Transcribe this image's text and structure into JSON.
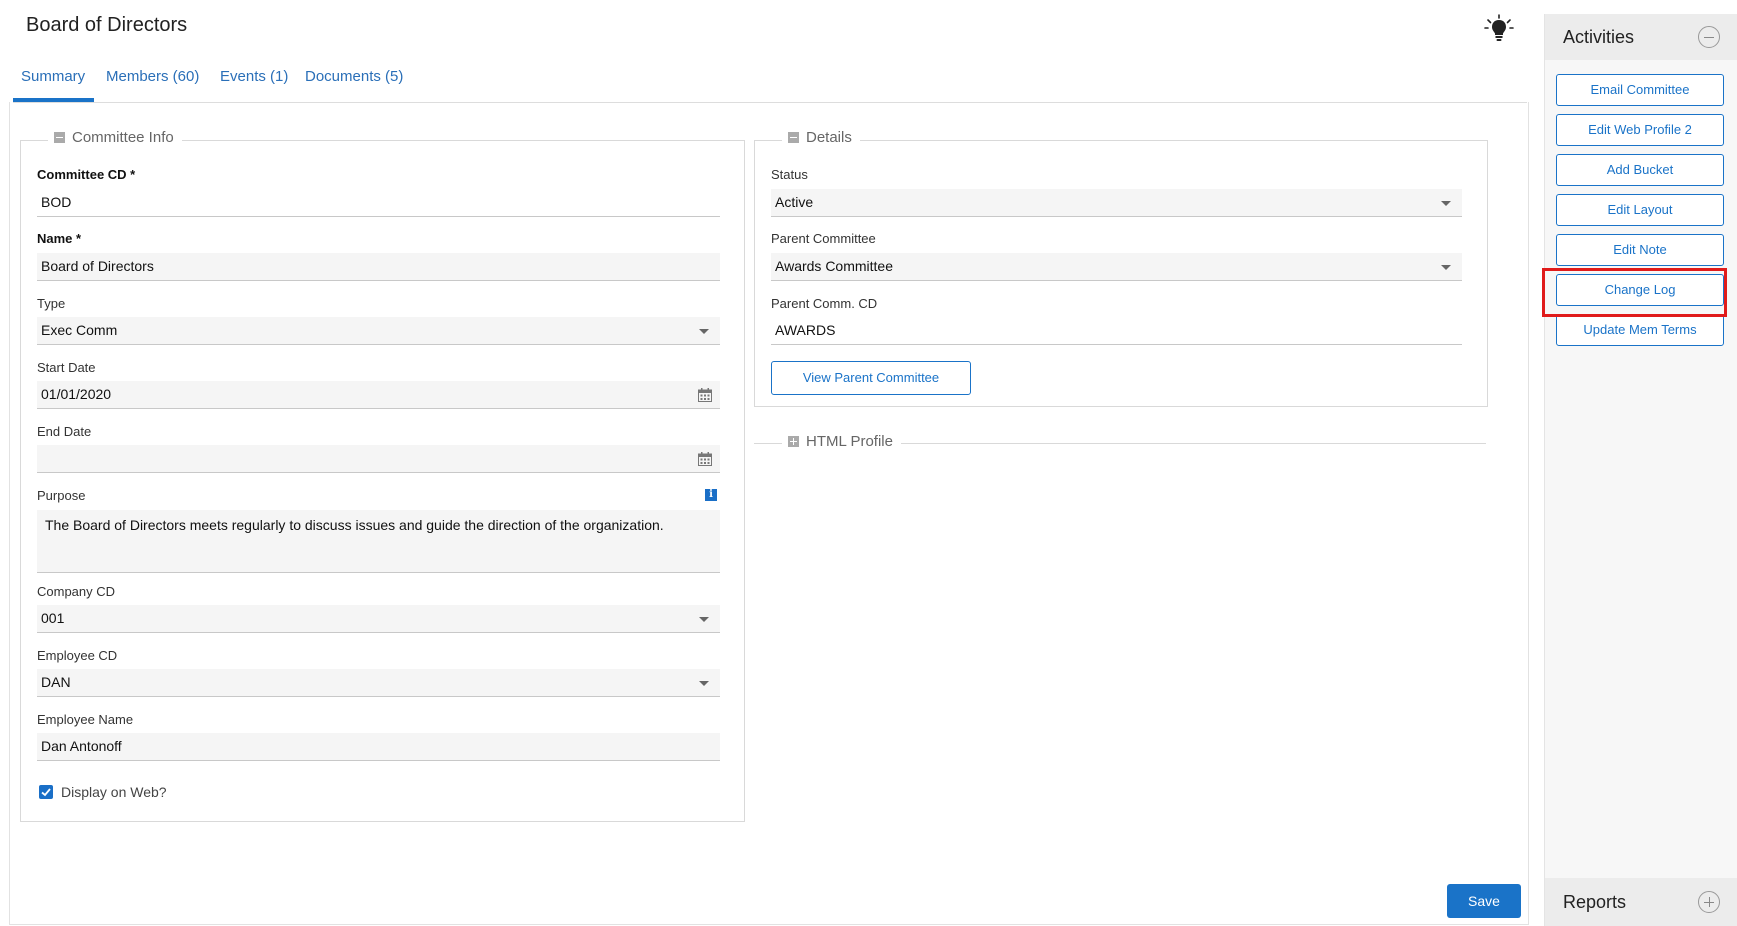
{
  "header": {
    "title": "Board of Directors",
    "tip_icon": "lightbulb-icon"
  },
  "tabs": [
    {
      "label": "Summary",
      "active": true
    },
    {
      "label": "Members (60)"
    },
    {
      "label": "Events (1)"
    },
    {
      "label": "Documents (5)"
    }
  ],
  "committee_info": {
    "legend": "Committee Info",
    "committee_cd": {
      "label": "Committee CD *",
      "value": "BOD"
    },
    "name": {
      "label": "Name *",
      "value": "Board of Directors"
    },
    "type": {
      "label": "Type",
      "value": "Exec Comm"
    },
    "start_date": {
      "label": "Start Date",
      "value": "01/01/2020"
    },
    "end_date": {
      "label": "End Date",
      "value": ""
    },
    "purpose": {
      "label": "Purpose",
      "info": "i",
      "value": "The Board of Directors meets regularly to discuss issues and guide the direction of the organization."
    },
    "company_cd": {
      "label": "Company CD",
      "value": "001"
    },
    "employee_cd": {
      "label": "Employee CD",
      "value": "DAN"
    },
    "employee_name": {
      "label": "Employee Name",
      "value": "Dan Antonoff"
    },
    "display_on_web": {
      "label": "Display on Web?",
      "checked": true
    }
  },
  "details": {
    "legend": "Details",
    "status": {
      "label": "Status",
      "value": "Active"
    },
    "parent_committee": {
      "label": "Parent Committee",
      "value": "Awards Committee"
    },
    "parent_comm_cd": {
      "label": "Parent Comm. CD",
      "value": "AWARDS"
    },
    "view_parent_button": "View Parent Committee"
  },
  "html_profile": {
    "legend": "HTML Profile"
  },
  "footer": {
    "save_label": "Save"
  },
  "sidebar": {
    "activities_title": "Activities",
    "reports_title": "Reports",
    "actions": [
      "Email Committee",
      "Edit Web Profile 2",
      "Add Bucket",
      "Edit Layout",
      "Edit Note",
      "Change Log",
      "Update Mem Terms"
    ],
    "highlighted_action": "Change Log"
  },
  "colors": {
    "accent": "#1a73c8",
    "highlight": "#e01b1b"
  }
}
